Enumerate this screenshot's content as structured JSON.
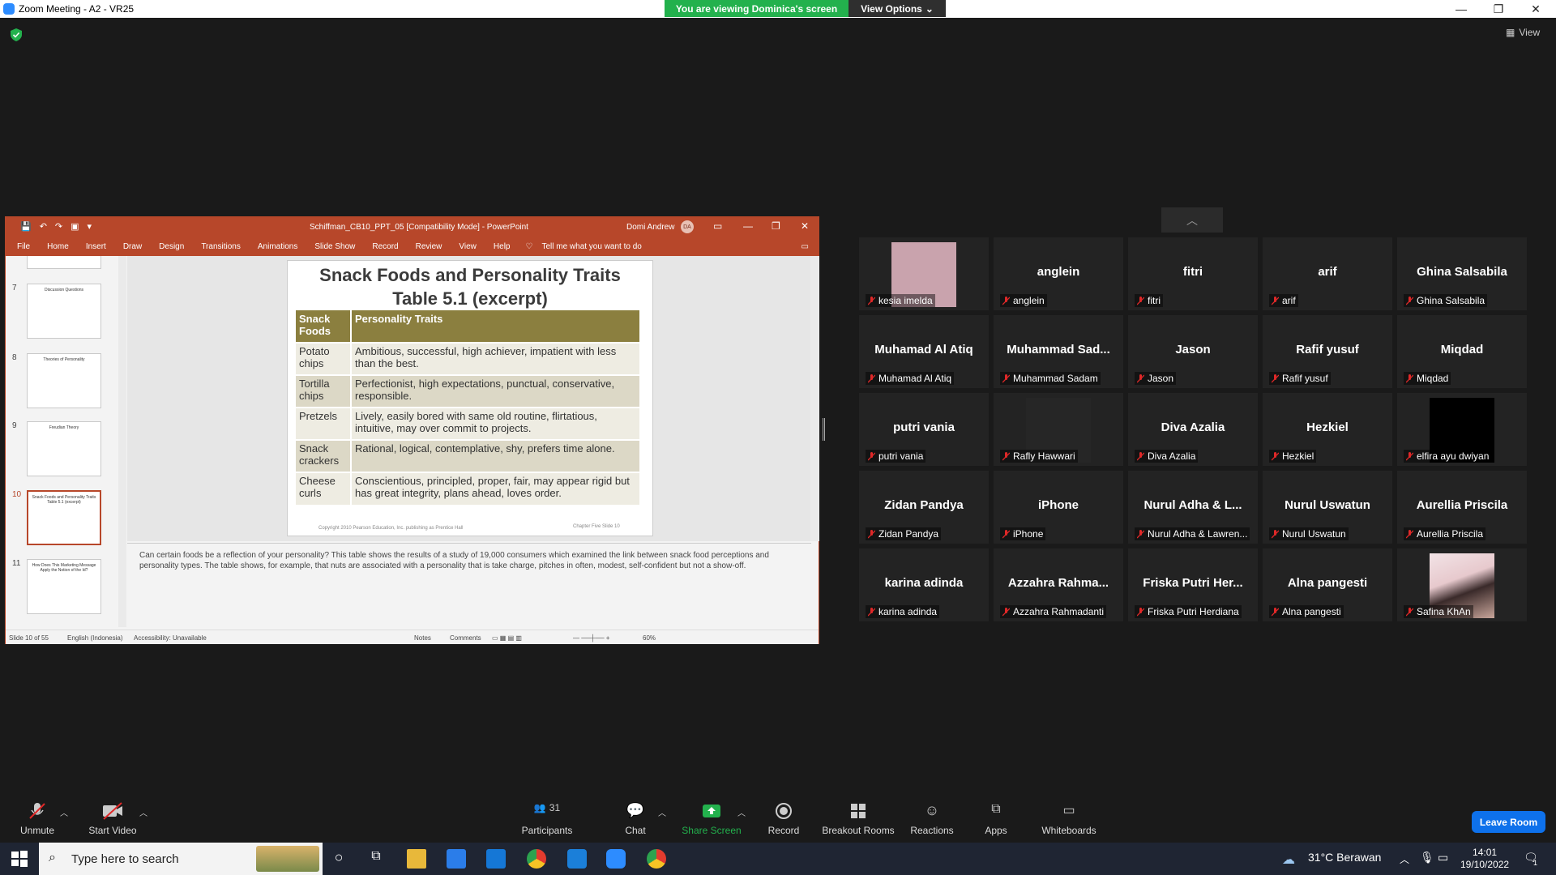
{
  "window": {
    "title": "Zoom Meeting - A2 - VR25",
    "viewing_banner": "You are viewing Dominica's screen",
    "view_options": "View Options",
    "view_label": "View"
  },
  "ppt": {
    "doc_title": "Schiffman_CB10_PPT_05 [Compatibility Mode] - PowerPoint",
    "user_name": "Domi Andrew",
    "user_initials": "DA",
    "tabs": [
      "File",
      "Home",
      "Insert",
      "Draw",
      "Design",
      "Transitions",
      "Animations",
      "Slide Show",
      "Record",
      "Review",
      "View",
      "Help"
    ],
    "tell_me": "Tell me what you want to do",
    "thumbnails": [
      {
        "num": "7",
        "title": "Discussion Questions"
      },
      {
        "num": "8",
        "title": "Theories of Personality"
      },
      {
        "num": "9",
        "title": "Freudian Theory"
      },
      {
        "num": "10",
        "title": "Snack Foods and Personality Traits Table 5.1 (excerpt)"
      },
      {
        "num": "11",
        "title": "How Does This Marketing Message Apply the Notion of the Id?"
      }
    ],
    "slide": {
      "title_line1": "Snack Foods and Personality Traits",
      "title_line2": "Table 5.1 (excerpt)",
      "headers": [
        "Snack Foods",
        "Personality Traits"
      ],
      "rows": [
        [
          "Potato chips",
          "Ambitious, successful, high achiever, impatient with less than the best."
        ],
        [
          "Tortilla chips",
          "Perfectionist, high expectations, punctual, conservative, responsible."
        ],
        [
          "Pretzels",
          "Lively, easily bored with same old routine, flirtatious, intuitive, may over commit to projects."
        ],
        [
          "Snack crackers",
          "Rational, logical, contemplative, shy, prefers time alone."
        ],
        [
          "Cheese curls",
          "Conscientious, principled, proper, fair, may appear rigid but has great integrity, plans ahead, loves order."
        ]
      ],
      "footer_left": "Copyright 2010 Pearson Education, Inc. publishing as Prentice Hall",
      "footer_right": "Chapter Five Slide  10"
    },
    "notes": "Can certain foods be a reflection of your personality?  This table shows the results of a study of 19,000 consumers which examined the link between snack food perceptions and personality types.  The table shows, for example, that nuts are associated with a personality that is take charge, pitches in often, modest, self-confident but not a show-off.",
    "status": {
      "slide": "Slide 10 of 55",
      "language": "English (Indonesia)",
      "accessibility": "Accessibility: Unavailable",
      "notes": "Notes",
      "comments": "Comments",
      "zoom": "60%"
    }
  },
  "participants": [
    {
      "big": "",
      "small": "kesia imelda",
      "video": "pink"
    },
    {
      "big": "anglein",
      "small": "anglein"
    },
    {
      "big": "fitri",
      "small": "fitri"
    },
    {
      "big": "arif",
      "small": "arif"
    },
    {
      "big": "Ghina Salsabila",
      "small": "Ghina Salsabila"
    },
    {
      "big": "Muhamad Al Atiq",
      "small": "Muhamad Al Atiq"
    },
    {
      "big": "Muhammad  Sad...",
      "small": "Muhammad Sadam"
    },
    {
      "big": "Jason",
      "small": "Jason"
    },
    {
      "big": "Rafif yusuf",
      "small": "Rafif yusuf"
    },
    {
      "big": "Miqdad",
      "small": "Miqdad"
    },
    {
      "big": "putri vania",
      "small": "putri vania"
    },
    {
      "big": "",
      "small": "Rafly Hawwari",
      "video": "dark"
    },
    {
      "big": "Diva Azalia",
      "small": "Diva Azalia"
    },
    {
      "big": "Hezkiel",
      "small": "Hezkiel"
    },
    {
      "big": "",
      "small": "elfira ayu dwiyan",
      "video": "black"
    },
    {
      "big": "Zidan Pandya",
      "small": "Zidan Pandya"
    },
    {
      "big": "iPhone",
      "small": "iPhone"
    },
    {
      "big": "Nurul Adha & L...",
      "small": "Nurul Adha & Lawren..."
    },
    {
      "big": "Nurul Uswatun",
      "small": "Nurul Uswatun"
    },
    {
      "big": "Aurellia Priscila",
      "small": "Aurellia Priscila"
    },
    {
      "big": "karina adinda",
      "small": "karina adinda"
    },
    {
      "big": "Azzahra  Rahma...",
      "small": "Azzahra Rahmadanti"
    },
    {
      "big": "Friska  Putri  Her...",
      "small": "Friska Putri Herdiana"
    },
    {
      "big": "Alna pangesti",
      "small": "Alna pangesti"
    },
    {
      "big": "",
      "small": "Safina KhAn",
      "video": "photo"
    }
  ],
  "toolbar": {
    "unmute": "Unmute",
    "start_video": "Start Video",
    "participants": "Participants",
    "participant_count": "31",
    "chat": "Chat",
    "share_screen": "Share Screen",
    "record": "Record",
    "breakout_rooms": "Breakout Rooms",
    "reactions": "Reactions",
    "apps": "Apps",
    "whiteboards": "Whiteboards",
    "leave": "Leave Room"
  },
  "taskbar": {
    "search_placeholder": "Type here to search",
    "weather": "31°C  Berawan",
    "time": "14:01",
    "date": "19/10/2022",
    "notification_count": "1"
  },
  "colors": {
    "zoom_bg": "#1a1a1a",
    "tile_bg": "#232323",
    "banner_green": "#23b14d",
    "ppt_red": "#b7472a",
    "table_header": "#8b7f3f",
    "leave_blue": "#0e71eb",
    "mute_red": "#e02828"
  }
}
